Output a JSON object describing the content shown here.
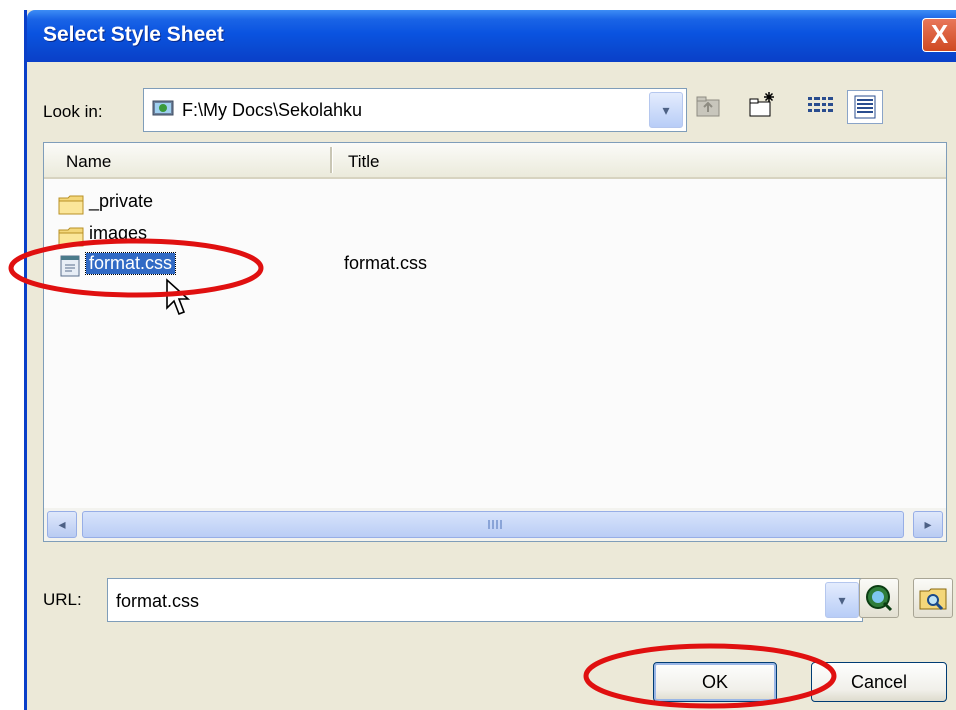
{
  "window": {
    "title": "Select Style Sheet",
    "close_glyph": "X"
  },
  "look_in": {
    "label": "Look in:",
    "value": "F:\\My Docs\\Sekolahku",
    "arrow_glyph": "▾"
  },
  "toolbar": {
    "icons": [
      "up-folder-icon",
      "new-folder-icon",
      "list-view-icon",
      "details-view-icon"
    ]
  },
  "file_list": {
    "columns": {
      "name": "Name",
      "title": "Title"
    },
    "rows": [
      {
        "name": "_private",
        "title": "",
        "type": "folder"
      },
      {
        "name": "images",
        "title": "",
        "type": "folder"
      },
      {
        "name": "format.css",
        "title": "format.css",
        "type": "file",
        "selected": true
      }
    ]
  },
  "scrollbar": {
    "left_glyph": "◂",
    "right_glyph": "▸"
  },
  "url": {
    "label": "URL:",
    "value": "format.css",
    "arrow_glyph": "▾"
  },
  "buttons": {
    "ok": "OK",
    "cancel": "Cancel"
  },
  "annotations": {
    "ring_color": "#e01010"
  },
  "colors": {
    "titlebar": "#0a53e0",
    "dialog_bg": "#ece9d8",
    "selection": "#316ac5"
  }
}
